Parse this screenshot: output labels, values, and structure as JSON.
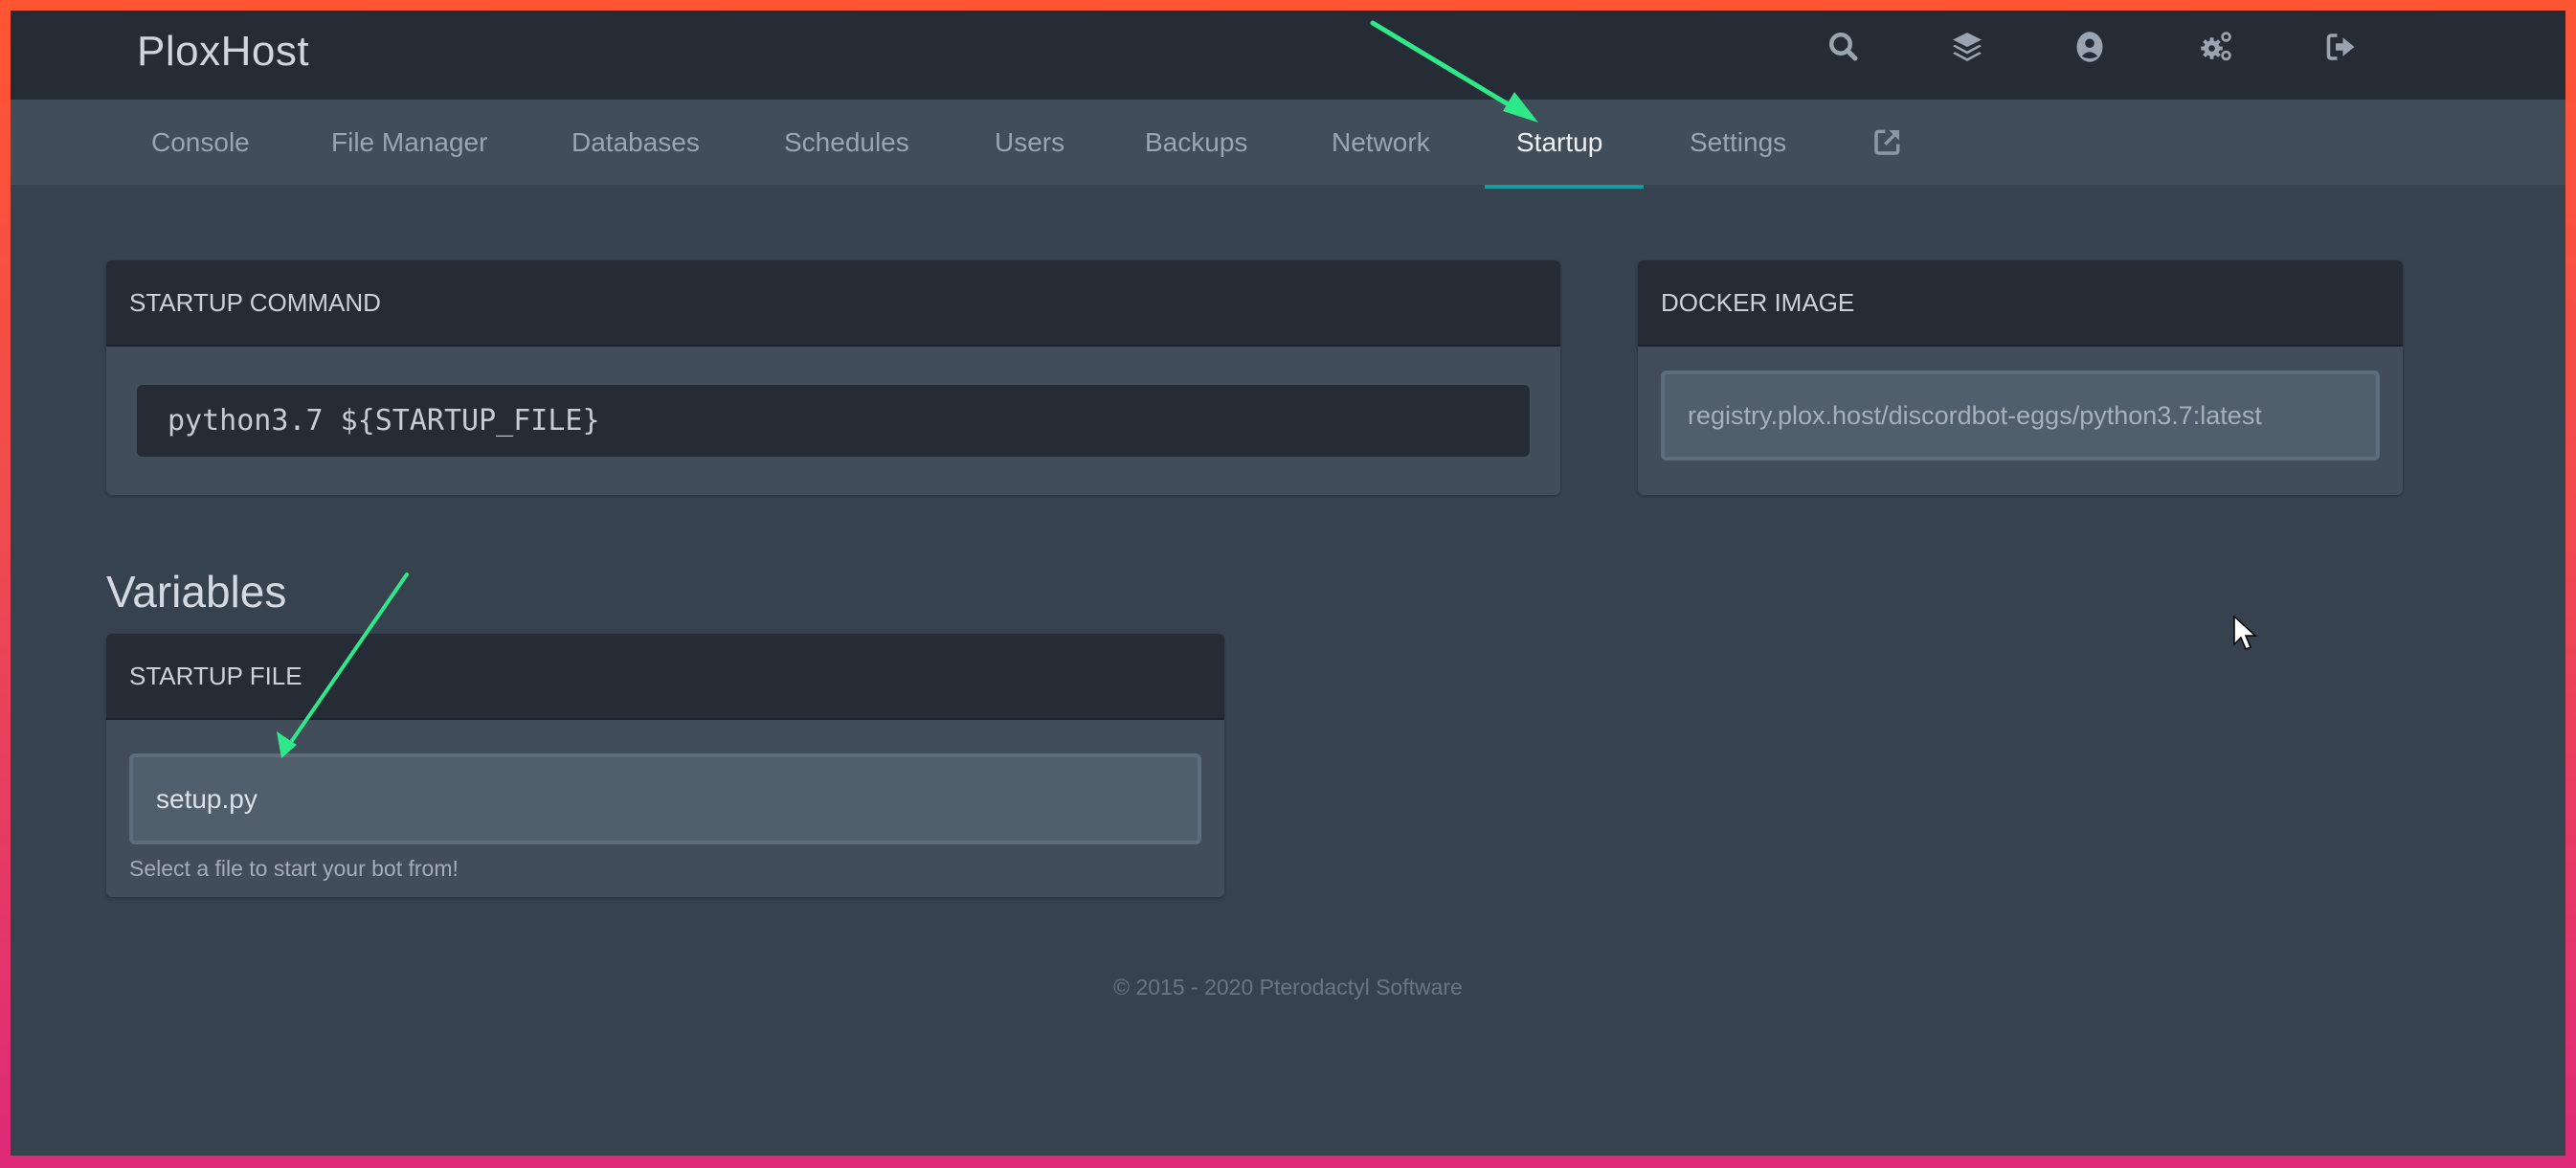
{
  "app": {
    "brand": "PloxHost",
    "accent_color": "#139ca0",
    "annotation_color": "#2ee88a"
  },
  "topbar": {
    "icons": [
      {
        "name": "search-icon"
      },
      {
        "name": "layers-icon"
      },
      {
        "name": "user-circle-icon"
      },
      {
        "name": "cogs-icon"
      },
      {
        "name": "sign-out-icon"
      }
    ]
  },
  "nav": {
    "items": [
      {
        "label": "Console"
      },
      {
        "label": "File Manager"
      },
      {
        "label": "Databases"
      },
      {
        "label": "Schedules"
      },
      {
        "label": "Users"
      },
      {
        "label": "Backups"
      },
      {
        "label": "Network"
      },
      {
        "label": "Startup",
        "active": true
      },
      {
        "label": "Settings"
      }
    ],
    "external_icon": "external-link-icon"
  },
  "startup_command": {
    "title": "Startup Command",
    "command": "python3.7 ${STARTUP_FILE}"
  },
  "docker_image": {
    "title": "Docker Image",
    "value": "registry.plox.host/discordbot-eggs/python3.7:latest"
  },
  "variables": {
    "heading": "Variables",
    "items": [
      {
        "title": "Startup File",
        "value": "setup.py",
        "description": "Select a file to start your bot from!"
      }
    ]
  },
  "footer": {
    "text": "© 2015 - 2020 Pterodactyl Software"
  }
}
